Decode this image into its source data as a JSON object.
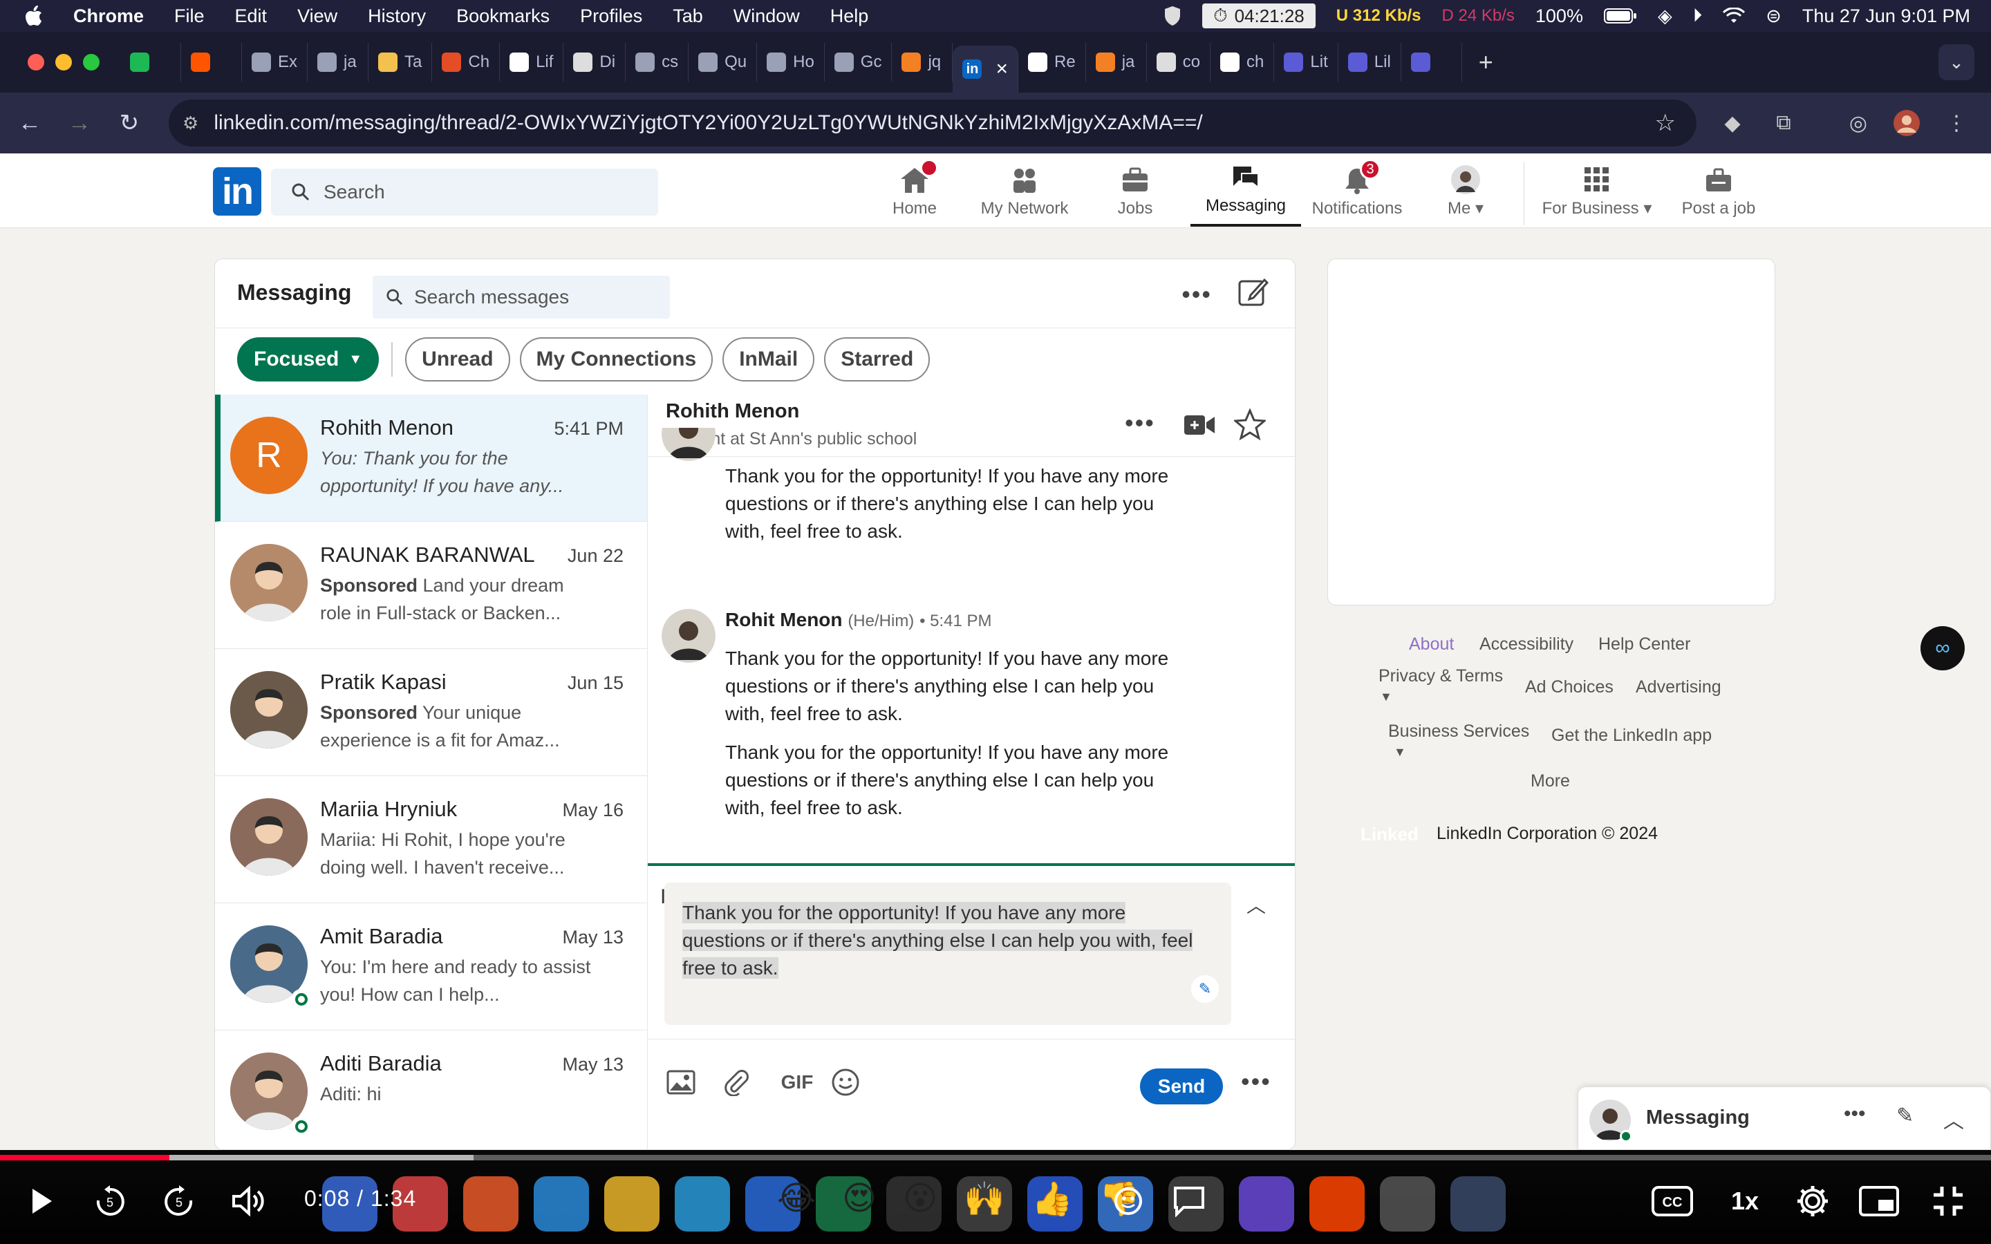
{
  "menubar": {
    "apple": "",
    "app_name": "Chrome",
    "items": [
      "File",
      "Edit",
      "View",
      "History",
      "Bookmarks",
      "Profiles",
      "Tab",
      "Window",
      "Help"
    ],
    "timer": "04:21:28",
    "net_up": "U  312 Kb/s",
    "net_down": "D  24 Kb/s",
    "battery": "100%",
    "datetime": "Thu 27 Jun  9:01 PM"
  },
  "tabs": [
    {
      "label": "",
      "color": "#1db954"
    },
    {
      "label": "",
      "color": "#ff5500"
    },
    {
      "label": "Ex",
      "color": "#9aa0b5"
    },
    {
      "label": "ja",
      "color": "#9aa0b5"
    },
    {
      "label": "Ta",
      "color": "#f2c14e"
    },
    {
      "label": "Ch",
      "color": "#e44d26"
    },
    {
      "label": "Lif",
      "color": "#ffffff"
    },
    {
      "label": "Di",
      "color": "#dddddd"
    },
    {
      "label": "cs",
      "color": "#9aa0b5"
    },
    {
      "label": "Qu",
      "color": "#9aa0b5"
    },
    {
      "label": "Ho",
      "color": "#9aa0b5"
    },
    {
      "label": "Gc",
      "color": "#9aa0b5"
    },
    {
      "label": "jq",
      "color": "#f48024"
    },
    {
      "label": "",
      "color": "#0a66c2",
      "active": true
    },
    {
      "label": "Re",
      "color": "#ffffff"
    },
    {
      "label": "ja",
      "color": "#f48024"
    },
    {
      "label": "co",
      "color": "#dddddd"
    },
    {
      "label": "ch",
      "color": "#ffffff"
    },
    {
      "label": "Lit",
      "color": "#5b5bd6"
    },
    {
      "label": "Lil",
      "color": "#5b5bd6"
    },
    {
      "label": "",
      "color": "#5b5bd6"
    }
  ],
  "active_tab_close": "×",
  "new_tab": "+",
  "address": {
    "url": "linkedin.com/messaging/thread/2-OWIxYWZiYjgtOTY2Yi00Y2UzLTg0YWUtNGNkYzhiM2IxMjgyXzAxMA==/"
  },
  "linkedin": {
    "logo": "in",
    "search_placeholder": "Search",
    "nav": [
      {
        "label": "Home",
        "badge": ""
      },
      {
        "label": "My Network",
        "badge": ""
      },
      {
        "label": "Jobs",
        "badge": ""
      },
      {
        "label": "Messaging",
        "badge": "",
        "active": true
      },
      {
        "label": "Notifications",
        "badge": "3"
      },
      {
        "label": "Me ▾",
        "badge": ""
      },
      {
        "label": "For Business ▾",
        "badge": ""
      },
      {
        "label": "Post a job",
        "badge": ""
      }
    ]
  },
  "messaging": {
    "title": "Messaging",
    "search_placeholder": "Search messages",
    "more": "•••",
    "filters": [
      "Focused",
      "Unread",
      "My Connections",
      "InMail",
      "Starred"
    ],
    "conversations": [
      {
        "name": "Rohith Menon",
        "date": "5:41 PM",
        "preview": "You: Thank you for the opportunity! If you have any...",
        "sponsored": "",
        "initial": "R",
        "avatar_color": "#e8731a",
        "active": true,
        "online": false
      },
      {
        "name": "RAUNAK BARANWAL",
        "date": "Jun 22",
        "sponsored": "Sponsored",
        "preview": "Land your dream role in Full-stack or Backen...",
        "initial": "",
        "avatar_color": "#b58a6a",
        "active": false,
        "online": false
      },
      {
        "name": "Pratik Kapasi",
        "date": "Jun 15",
        "sponsored": "Sponsored",
        "preview": "Your unique experience is a fit for Amaz...",
        "initial": "",
        "avatar_color": "#6b5a4a",
        "active": false,
        "online": false
      },
      {
        "name": "Mariia Hryniuk",
        "date": "May 16",
        "sponsored": "",
        "preview": "Mariia: Hi Rohit, I hope you're doing well. I haven't receive...",
        "initial": "",
        "avatar_color": "#8a6a5a",
        "active": false,
        "online": false
      },
      {
        "name": "Amit Baradia",
        "date": "May 13",
        "sponsored": "",
        "preview": "You: I'm here and ready to assist you! How can I help...",
        "initial": "",
        "avatar_color": "#4a6a8a",
        "active": false,
        "online": true
      },
      {
        "name": "Aditi Baradia",
        "date": "May 13",
        "sponsored": "",
        "preview": "Aditi: hi",
        "initial": "",
        "avatar_color": "#9a7a6a",
        "active": false,
        "online": true
      }
    ],
    "thread": {
      "name": "Rohith Menon",
      "subtitle": "Student at St Ann's public school",
      "messages": [
        {
          "text": "Thank you for the opportunity! If you have any more questions or if there's anything else I can help you with, feel free to ask."
        },
        {
          "sender": "Rohit Menon",
          "pronoun": "(He/Him)",
          "time": "• 5:41 PM",
          "text": "Thank you for the opportunity! If you have any more questions or if there's anything else I can help you with, feel free to ask."
        },
        {
          "text": "Thank you for the opportunity! If you have any more questions or if there's anything else I can help you with, feel free to ask."
        }
      ],
      "compose_value": "Thank you for the opportunity! If you have any more questions or if there's anything else I can help you with, feel free to ask.",
      "gif_label": "GIF",
      "send_label": "Send"
    }
  },
  "footer": {
    "links": [
      "About",
      "Accessibility",
      "Help Center",
      "Privacy & Terms",
      "Ad Choices",
      "Advertising",
      "Business Services",
      "Get the LinkedIn app",
      "More"
    ],
    "wordmark": "Linked",
    "copyright": "LinkedIn Corporation © 2024"
  },
  "widget": {
    "title": "Messaging"
  },
  "video": {
    "current_time": "0:08",
    "separator": "/",
    "duration": "1:34",
    "progress_fraction": 0.085,
    "buffered_fraction": 0.238,
    "speed": "1x",
    "emoji": [
      "😂",
      "😍",
      "😮",
      "🙌",
      "👍",
      "👎"
    ]
  }
}
